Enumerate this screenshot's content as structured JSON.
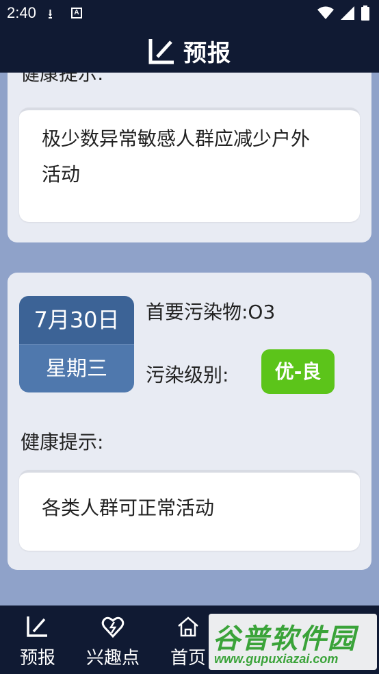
{
  "status_bar": {
    "time": "2:40",
    "icons": [
      "download-icon",
      "a-icon",
      "wifi-icon",
      "signal-icon",
      "battery-icon"
    ]
  },
  "app_bar": {
    "title": "预报",
    "icon": "forecast-icon"
  },
  "forecast_cards": [
    {
      "health_label": "健康提示:",
      "health_tip": "极少数异常敏感人群应减少户外活动"
    },
    {
      "date": "7月30日",
      "weekday": "星期三",
      "pollutant_text": "首要污染物:O3",
      "level_label": "污染级别:",
      "level_value": "优-良",
      "level_color": "#5cc41a",
      "health_label": "健康提示:",
      "health_tip": "各类人群可正常活动"
    }
  ],
  "bottom_nav": {
    "items": [
      {
        "label": "预报",
        "icon": "forecast-icon",
        "active": true
      },
      {
        "label": "兴趣点",
        "icon": "heart-pin-icon",
        "active": false
      },
      {
        "label": "首页",
        "icon": "home-icon",
        "active": false
      }
    ]
  },
  "watermark": {
    "main": "谷普软件园",
    "url": "www.gupuxiazai.com"
  },
  "colors": {
    "bar_bg": "#101a33",
    "page_bg": "#8fa2c9",
    "card_bg": "#e8ebf3",
    "date_top": "#3c6396",
    "date_bottom": "#4f78ad"
  }
}
